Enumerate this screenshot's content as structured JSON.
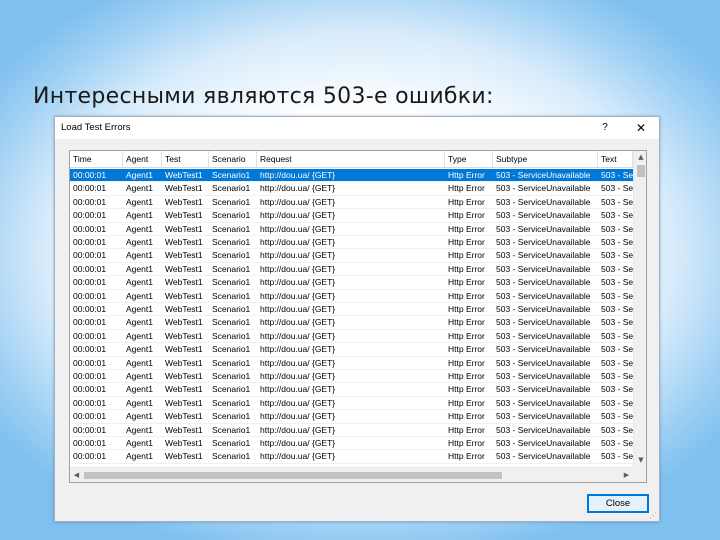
{
  "slide": {
    "title": "Интересными являются 503-е ошибки:"
  },
  "dialog": {
    "title": "Load Test Errors",
    "help_glyph": "?",
    "close_glyph": "✕",
    "close_button_label": "Close"
  },
  "grid": {
    "columns": [
      "Time",
      "Agent",
      "Test",
      "Scenario",
      "Request",
      "Type",
      "Subtype",
      "Text"
    ],
    "selected_row_index": 0,
    "rows": [
      [
        "00:00:01",
        "Agent1",
        "WebTest1",
        "Scenario1",
        "http://dou.ua/ {GET}",
        "Http Error",
        "503 - ServiceUnavailable",
        "503 - Se"
      ],
      [
        "00:00:01",
        "Agent1",
        "WebTest1",
        "Scenario1",
        "http://dou.ua/ {GET}",
        "Http Error",
        "503 - ServiceUnavailable",
        "503 - Se"
      ],
      [
        "00:00:01",
        "Agent1",
        "WebTest1",
        "Scenario1",
        "http://dou.ua/ {GET}",
        "Http Error",
        "503 - ServiceUnavailable",
        "503 - Se"
      ],
      [
        "00:00:01",
        "Agent1",
        "WebTest1",
        "Scenario1",
        "http://dou.ua/ {GET}",
        "Http Error",
        "503 - ServiceUnavailable",
        "503 - Se"
      ],
      [
        "00:00:01",
        "Agent1",
        "WebTest1",
        "Scenario1",
        "http://dou.ua/ {GET}",
        "Http Error",
        "503 - ServiceUnavailable",
        "503 - Se"
      ],
      [
        "00:00:01",
        "Agent1",
        "WebTest1",
        "Scenario1",
        "http://dou.ua/ {GET}",
        "Http Error",
        "503 - ServiceUnavailable",
        "503 - Se"
      ],
      [
        "00:00:01",
        "Agent1",
        "WebTest1",
        "Scenario1",
        "http://dou.ua/ {GET}",
        "Http Error",
        "503 - ServiceUnavailable",
        "503 - Se"
      ],
      [
        "00:00:01",
        "Agent1",
        "WebTest1",
        "Scenario1",
        "http://dou.ua/ {GET}",
        "Http Error",
        "503 - ServiceUnavailable",
        "503 - Se"
      ],
      [
        "00:00:01",
        "Agent1",
        "WebTest1",
        "Scenario1",
        "http://dou.ua/ {GET}",
        "Http Error",
        "503 - ServiceUnavailable",
        "503 - Se"
      ],
      [
        "00:00:01",
        "Agent1",
        "WebTest1",
        "Scenario1",
        "http://dou.ua/ {GET}",
        "Http Error",
        "503 - ServiceUnavailable",
        "503 - Se"
      ],
      [
        "00:00:01",
        "Agent1",
        "WebTest1",
        "Scenario1",
        "http://dou.ua/ {GET}",
        "Http Error",
        "503 - ServiceUnavailable",
        "503 - Se"
      ],
      [
        "00:00:01",
        "Agent1",
        "WebTest1",
        "Scenario1",
        "http://dou.ua/ {GET}",
        "Http Error",
        "503 - ServiceUnavailable",
        "503 - Se"
      ],
      [
        "00:00:01",
        "Agent1",
        "WebTest1",
        "Scenario1",
        "http://dou.ua/ {GET}",
        "Http Error",
        "503 - ServiceUnavailable",
        "503 - Se"
      ],
      [
        "00:00:01",
        "Agent1",
        "WebTest1",
        "Scenario1",
        "http://dou.ua/ {GET}",
        "Http Error",
        "503 - ServiceUnavailable",
        "503 - Se"
      ],
      [
        "00:00:01",
        "Agent1",
        "WebTest1",
        "Scenario1",
        "http://dou.ua/ {GET}",
        "Http Error",
        "503 - ServiceUnavailable",
        "503 - Se"
      ],
      [
        "00:00:01",
        "Agent1",
        "WebTest1",
        "Scenario1",
        "http://dou.ua/ {GET}",
        "Http Error",
        "503 - ServiceUnavailable",
        "503 - Se"
      ],
      [
        "00:00:01",
        "Agent1",
        "WebTest1",
        "Scenario1",
        "http://dou.ua/ {GET}",
        "Http Error",
        "503 - ServiceUnavailable",
        "503 - Se"
      ],
      [
        "00:00:01",
        "Agent1",
        "WebTest1",
        "Scenario1",
        "http://dou.ua/ {GET}",
        "Http Error",
        "503 - ServiceUnavailable",
        "503 - Se"
      ],
      [
        "00:00:01",
        "Agent1",
        "WebTest1",
        "Scenario1",
        "http://dou.ua/ {GET}",
        "Http Error",
        "503 - ServiceUnavailable",
        "503 - Se"
      ],
      [
        "00:00:01",
        "Agent1",
        "WebTest1",
        "Scenario1",
        "http://dou.ua/ {GET}",
        "Http Error",
        "503 - ServiceUnavailable",
        "503 - Se"
      ],
      [
        "00:00:01",
        "Agent1",
        "WebTest1",
        "Scenario1",
        "http://dou.ua/ {GET}",
        "Http Error",
        "503 - ServiceUnavailable",
        "503 - Se"
      ],
      [
        "00:00:01",
        "Agent1",
        "WebTest1",
        "Scenario1",
        "http://dou.ua/ {GET}",
        "Http Error",
        "503 - ServiceUnavailable",
        "503 - Se"
      ],
      [
        "00:00:01",
        "Agent1",
        "WebTest1",
        "Scenario1",
        "http://dou.ua/ {GET}",
        "Http Error",
        "503 - ServiceUnavailable",
        "503 - Se"
      ]
    ]
  },
  "icons": {
    "scroll_up": "scroll-up-arrow-icon",
    "scroll_down": "scroll-down-arrow-icon",
    "scroll_left": "scroll-left-arrow-icon",
    "scroll_right": "scroll-right-arrow-icon",
    "resize": "resize-grip-icon"
  },
  "colors": {
    "selection": "#0078d7",
    "selection_text": "#ffffff",
    "button_border": "#0078d7"
  }
}
